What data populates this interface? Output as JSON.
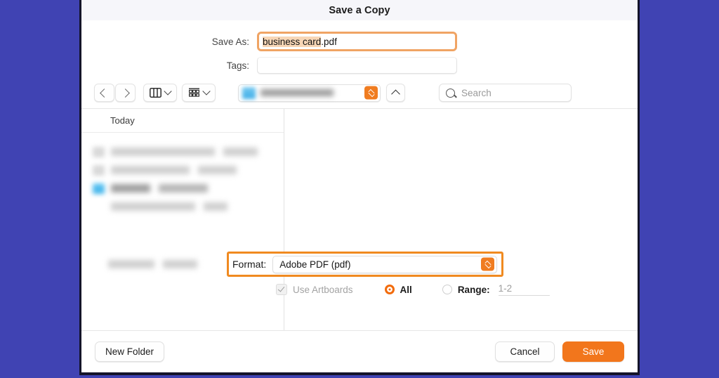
{
  "window": {
    "title": "Save a Copy",
    "accent_orange": "#f2761c",
    "highlight_orange": "#f08a20",
    "backdrop_blue": "#4043b3"
  },
  "form": {
    "save_as_label": "Save As:",
    "save_as_value_selected": "business card",
    "save_as_value_rest": ".pdf",
    "tags_label": "Tags:",
    "tags_value": ""
  },
  "toolbar": {
    "back_icon": "chevron-left-icon",
    "forward_icon": "chevron-right-icon",
    "column_view_icon": "column-view-icon",
    "gallery_view_icon": "gallery-view-icon",
    "location_stepper_icon": "up-down-stepper-icon",
    "collapse_icon": "chevron-up-icon",
    "search_icon": "search-icon",
    "search_placeholder": "Search"
  },
  "browser": {
    "section_header": "Today",
    "rows": [
      {
        "icon": "file-icon",
        "selected": false
      },
      {
        "icon": "file-icon",
        "selected": false
      },
      {
        "icon": "folder-icon",
        "selected": true
      },
      {
        "icon": "file-icon",
        "selected": false
      },
      {
        "icon": "file-icon",
        "selected": false
      }
    ]
  },
  "format": {
    "label": "Format:",
    "value": "Adobe PDF (pdf)",
    "stepper_icon": "up-down-stepper-icon"
  },
  "options": {
    "use_artboards_label": "Use Artboards",
    "use_artboards_checked": true,
    "all_label": "All",
    "all_selected": true,
    "range_label": "Range:",
    "range_selected": false,
    "range_value": "1-2"
  },
  "footer": {
    "new_folder_label": "New Folder",
    "cancel_label": "Cancel",
    "save_label": "Save"
  }
}
